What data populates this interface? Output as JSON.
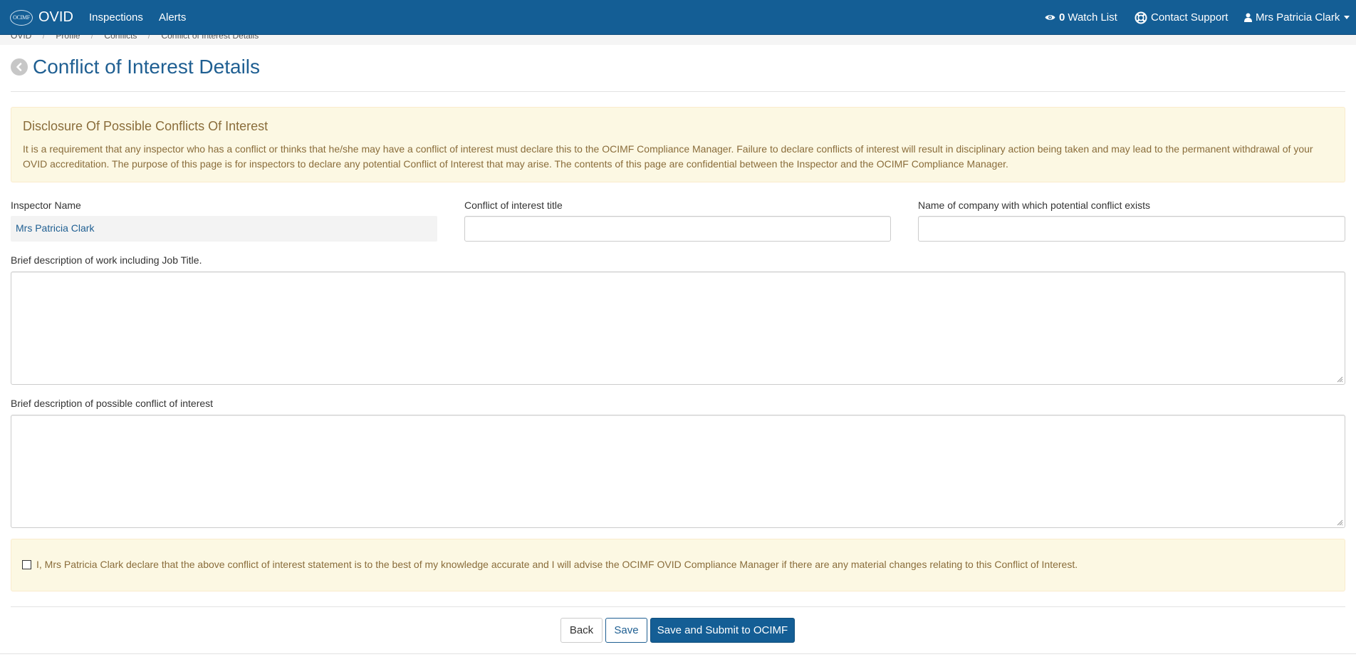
{
  "navbar": {
    "logo_text": "OCIMF",
    "brand": "OVID",
    "links": [
      {
        "label": "Inspections"
      },
      {
        "label": "Alerts"
      }
    ],
    "watch_count": "0",
    "watch_label": "Watch List",
    "support_label": "Contact Support",
    "user_label": "Mrs Patricia Clark"
  },
  "breadcrumb": [
    "OVID",
    "Profile",
    "Conflicts",
    "Conflict of Interest Details"
  ],
  "page": {
    "title": "Conflict of Interest Details"
  },
  "disclosure": {
    "heading": "Disclosure Of Possible Conflicts Of Interest",
    "body": "It is a requirement that any inspector who has a conflict or thinks that he/she may have a conflict of interest must declare this to the OCIMF Compliance Manager. Failure to declare conflicts of interest will result in disciplinary action being taken and may lead to the permanent withdrawal of your OVID accreditation. The purpose of this page is for inspectors to declare any potential Conflict of Interest that may arise. The contents of this page are confidential between the Inspector and the OCIMF Compliance Manager."
  },
  "form": {
    "inspector_name_label": "Inspector Name",
    "inspector_name_value": "Mrs Patricia Clark",
    "coi_title_label": "Conflict of interest title",
    "coi_title_value": "",
    "company_label": "Name of company with which potential conflict exists",
    "company_value": "",
    "work_desc_label": "Brief description of work including Job Title.",
    "work_desc_value": "",
    "conflict_desc_label": "Brief description of possible conflict of interest",
    "conflict_desc_value": ""
  },
  "declaration": {
    "checked": false,
    "text": "I, Mrs Patricia Clark declare that the above conflict of interest statement is to the best of my knowledge accurate and I will advise the OCIMF OVID Compliance Manager if there are any material changes relating to this Conflict of Interest."
  },
  "buttons": {
    "back": "Back",
    "save": "Save",
    "submit": "Save and Submit to OCIMF"
  },
  "colors": {
    "navbar": "#145e95",
    "title": "#1f5f92",
    "warning_bg": "#fcf8e3",
    "warning_text": "#8a6d3b"
  }
}
